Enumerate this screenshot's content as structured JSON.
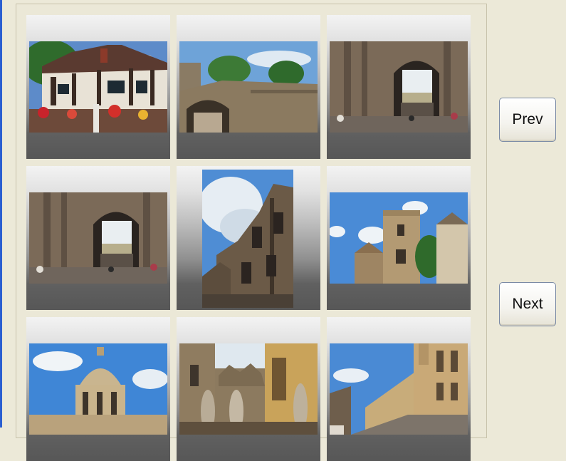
{
  "gallery": {
    "thumbnails": [
      {
        "subject": "tudor-building"
      },
      {
        "subject": "stone-archway-wall"
      },
      {
        "subject": "gate-archway"
      },
      {
        "subject": "gate-archway"
      },
      {
        "subject": "gothic-facade"
      },
      {
        "subject": "church-tower"
      },
      {
        "subject": "domed-building"
      },
      {
        "subject": "statues-courtyard"
      },
      {
        "subject": "street-colleges"
      }
    ]
  },
  "navigation": {
    "prev_label": "Prev",
    "next_label": "Next"
  },
  "colors": {
    "window_background": "#ece9d8",
    "window_border_accent": "#2b5fd1",
    "sky": "#3f86d6"
  }
}
